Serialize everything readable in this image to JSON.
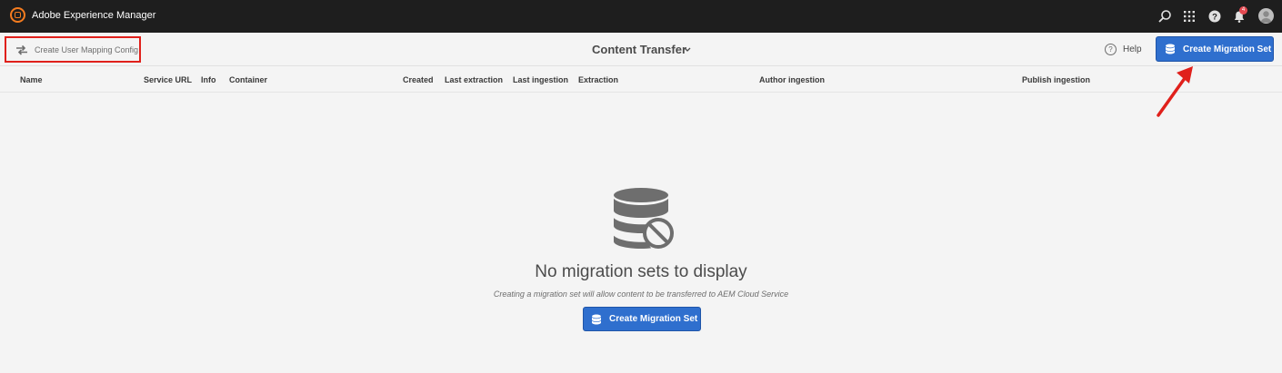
{
  "shell": {
    "app_title": "Adobe Experience Manager",
    "notification_count": "4",
    "icons": [
      "search-icon",
      "apps-grid-icon",
      "help-icon",
      "bell-icon",
      "user-avatar"
    ]
  },
  "actionbar": {
    "user_mapping_label": "Create User Mapping Config",
    "page_title": "Content Transfer",
    "help_label": "Help",
    "create_button_label": "Create Migration Set"
  },
  "table": {
    "columns": [
      "Name",
      "Service URL",
      "Info",
      "Container",
      "Created",
      "Last extraction",
      "Last ingestion",
      "Extraction",
      "Author ingestion",
      "Publish ingestion"
    ]
  },
  "empty_state": {
    "title": "No migration sets to display",
    "description": "Creating a migration set will allow content to be transferred to AEM Cloud Service",
    "button_label": "Create Migration Set"
  },
  "colors": {
    "shell_bg": "#1e1e1e",
    "brand_orange": "#f57c1f",
    "primary_blue": "#2f6fce",
    "annotation_red": "#e0201b"
  }
}
